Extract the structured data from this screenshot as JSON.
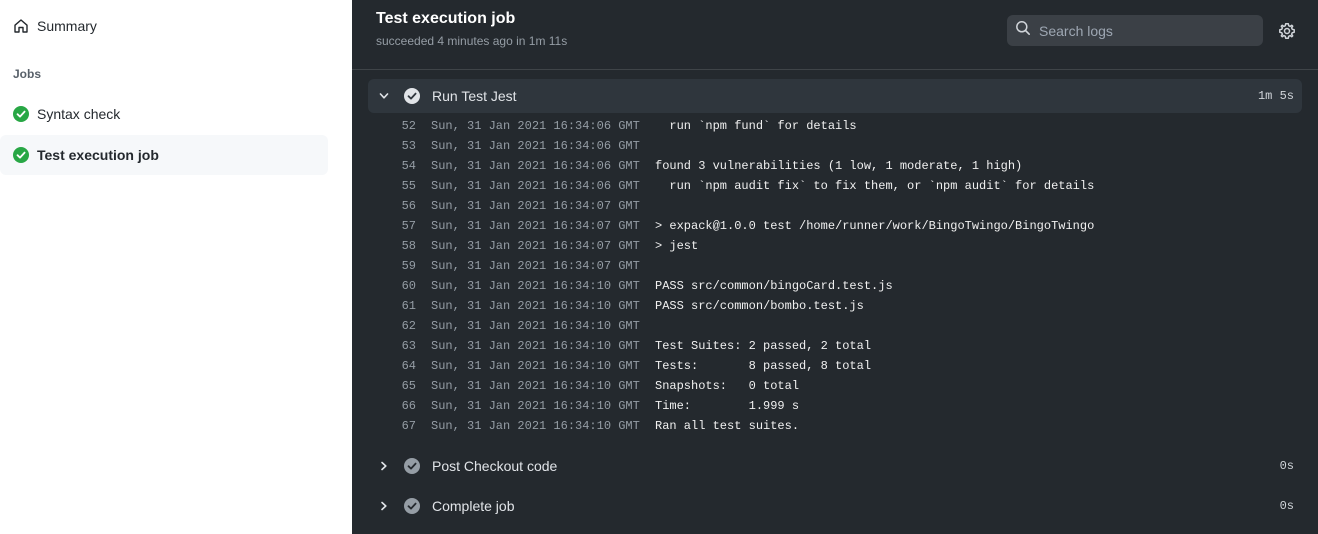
{
  "sidebar": {
    "summary": "Summary",
    "jobs_heading": "Jobs",
    "jobs": [
      {
        "label": "Syntax check"
      },
      {
        "label": "Test execution job"
      }
    ]
  },
  "header": {
    "title": "Test execution job",
    "subtitle": "succeeded 4 minutes ago in 1m 11s",
    "search_placeholder": "Search logs"
  },
  "steps": [
    {
      "name": "Run Test Jest",
      "duration": "1m 5s"
    },
    {
      "name": "Post Checkout code",
      "duration": "0s"
    },
    {
      "name": "Complete job",
      "duration": "0s"
    }
  ],
  "log_lines": [
    {
      "n": "52",
      "ts": "Sun, 31 Jan 2021 16:34:06 GMT",
      "msg": "  run `npm fund` for details"
    },
    {
      "n": "53",
      "ts": "Sun, 31 Jan 2021 16:34:06 GMT",
      "msg": ""
    },
    {
      "n": "54",
      "ts": "Sun, 31 Jan 2021 16:34:06 GMT",
      "msg": "found 3 vulnerabilities (1 low, 1 moderate, 1 high)"
    },
    {
      "n": "55",
      "ts": "Sun, 31 Jan 2021 16:34:06 GMT",
      "msg": "  run `npm audit fix` to fix them, or `npm audit` for details"
    },
    {
      "n": "56",
      "ts": "Sun, 31 Jan 2021 16:34:07 GMT",
      "msg": ""
    },
    {
      "n": "57",
      "ts": "Sun, 31 Jan 2021 16:34:07 GMT",
      "msg": "> expack@1.0.0 test /home/runner/work/BingoTwingo/BingoTwingo"
    },
    {
      "n": "58",
      "ts": "Sun, 31 Jan 2021 16:34:07 GMT",
      "msg": "> jest"
    },
    {
      "n": "59",
      "ts": "Sun, 31 Jan 2021 16:34:07 GMT",
      "msg": ""
    },
    {
      "n": "60",
      "ts": "Sun, 31 Jan 2021 16:34:10 GMT",
      "msg": "PASS src/common/bingoCard.test.js"
    },
    {
      "n": "61",
      "ts": "Sun, 31 Jan 2021 16:34:10 GMT",
      "msg": "PASS src/common/bombo.test.js"
    },
    {
      "n": "62",
      "ts": "Sun, 31 Jan 2021 16:34:10 GMT",
      "msg": ""
    },
    {
      "n": "63",
      "ts": "Sun, 31 Jan 2021 16:34:10 GMT",
      "msg": "Test Suites: 2 passed, 2 total"
    },
    {
      "n": "64",
      "ts": "Sun, 31 Jan 2021 16:34:10 GMT",
      "msg": "Tests:       8 passed, 8 total"
    },
    {
      "n": "65",
      "ts": "Sun, 31 Jan 2021 16:34:10 GMT",
      "msg": "Snapshots:   0 total"
    },
    {
      "n": "66",
      "ts": "Sun, 31 Jan 2021 16:34:10 GMT",
      "msg": "Time:        1.999 s"
    },
    {
      "n": "67",
      "ts": "Sun, 31 Jan 2021 16:34:10 GMT",
      "msg": "Ran all test suites."
    }
  ],
  "colors": {
    "success_green": "#28a745",
    "step_done_gray": "#959da5",
    "log_bg": "#24292e"
  }
}
